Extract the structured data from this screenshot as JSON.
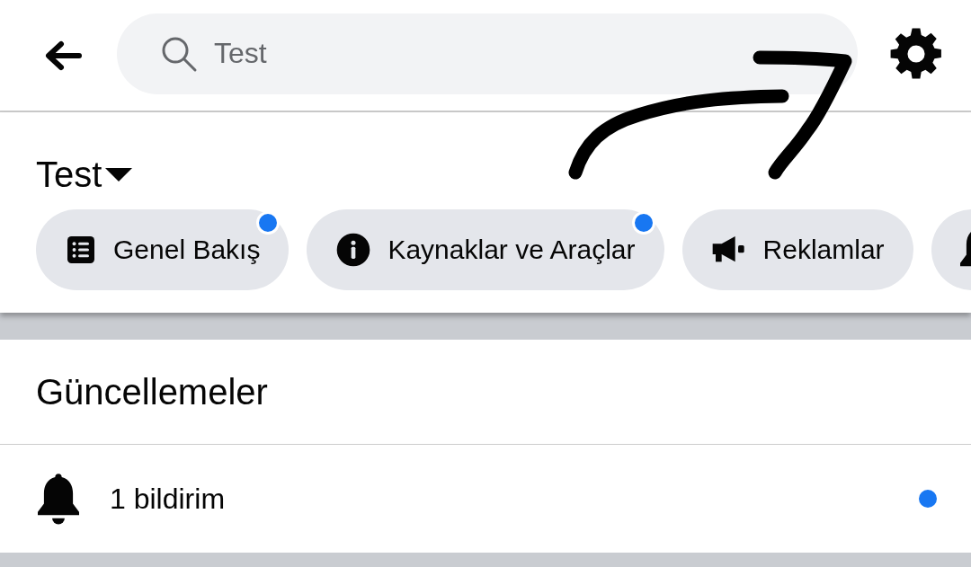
{
  "header": {
    "search": {
      "value": "Test"
    }
  },
  "page": {
    "title": "Test",
    "chips": [
      {
        "kind": "list",
        "label": "Genel Bakış",
        "dot": true
      },
      {
        "kind": "info",
        "label": "Kaynaklar ve Araçlar",
        "dot": true
      },
      {
        "kind": "megaphone",
        "label": "Reklamlar",
        "dot": false
      },
      {
        "kind": "bell"
      }
    ]
  },
  "updates": {
    "title": "Güncellemeler",
    "items": [
      {
        "kind": "bell",
        "label": "1 bildirim",
        "unread": true
      }
    ]
  }
}
